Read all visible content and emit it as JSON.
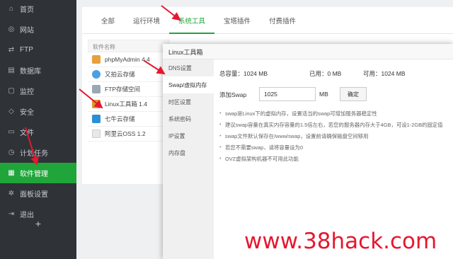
{
  "sidebar": {
    "items": [
      {
        "label": "首页",
        "icon": "home-icon"
      },
      {
        "label": "网站",
        "icon": "globe-icon"
      },
      {
        "label": "FTP",
        "icon": "ftp-icon"
      },
      {
        "label": "数据库",
        "icon": "database-icon"
      },
      {
        "label": "监控",
        "icon": "monitor-icon"
      },
      {
        "label": "安全",
        "icon": "shield-icon"
      },
      {
        "label": "文件",
        "icon": "folder-icon"
      },
      {
        "label": "计划任务",
        "icon": "clock-icon"
      },
      {
        "label": "软件管理",
        "icon": "grid-icon"
      },
      {
        "label": "面板设置",
        "icon": "gear-icon"
      },
      {
        "label": "退出",
        "icon": "logout-icon"
      }
    ],
    "active_index": 8,
    "add_label": "+"
  },
  "tabs": [
    "全部",
    "运行环境",
    "系统工具",
    "宝塔插件",
    "付费插件"
  ],
  "active_tab": 2,
  "software_list": {
    "header": "软件名称",
    "items": [
      {
        "name": "phpMyAdmin 4.4",
        "color": "#e8a03a"
      },
      {
        "name": "又拍云存储",
        "color": "#4aa0e6"
      },
      {
        "name": "FTP存储空间",
        "color": "#9aa8b5"
      },
      {
        "name": "Linux工具箱 1.4",
        "color": "#d89a2e"
      },
      {
        "name": "七牛云存储",
        "color": "#2b8fd6"
      },
      {
        "name": "阿里云OSS 1.2",
        "color": "#e8e8e8"
      }
    ]
  },
  "modal": {
    "title": "Linux工具箱",
    "nav": [
      "DNS设置",
      "Swap/虚拟内存",
      "时区设置",
      "系统密码",
      "IP设置",
      "内存盘"
    ],
    "active_nav": 1,
    "stats": {
      "total": "总容量：1024 MB",
      "used": "已用：0 MB",
      "available": "可用：1024 MB"
    },
    "add_label": "添加Swap",
    "add_value": "1025",
    "add_unit": "MB",
    "confirm_label": "确定",
    "tips": [
      "swap是Linux下的虚拟内存，设置适当的swap可增加服务器稳定性",
      "建议swap容量在真实内存容量的1.5倍左右，若您的服务器内存大于4GB，可设1-2GB的固定值",
      "swap文件默认保存在/www/swap，设置前请确保磁盘空间够用",
      "若您不需要swap，请将容量设为0",
      "OVZ虚拟架构机器不可用此功能"
    ]
  },
  "watermark": "www.38hack.com",
  "colors": {
    "accent": "#20a53a",
    "sidebar_bg": "#2f3338",
    "arrow": "#e6172f"
  }
}
